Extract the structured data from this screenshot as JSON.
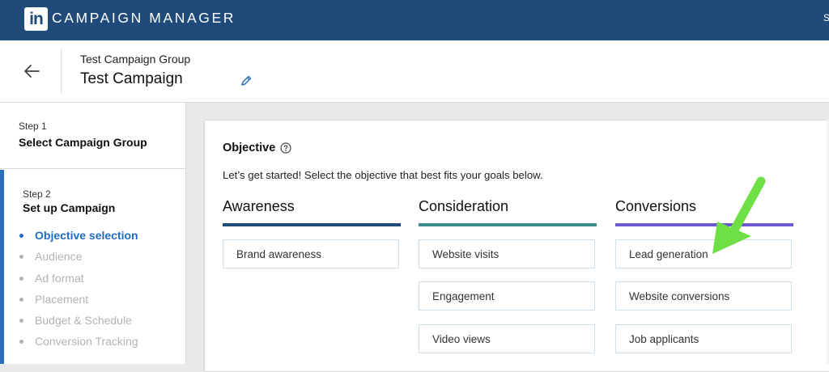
{
  "app": {
    "logo_text": "in",
    "title": "CAMPAIGN MANAGER",
    "top_right_text": "S"
  },
  "header": {
    "group_name": "Test Campaign Group",
    "campaign_name": "Test Campaign"
  },
  "sidebar": {
    "step1": {
      "label": "Step 1",
      "title": "Select Campaign Group"
    },
    "step2": {
      "label": "Step 2",
      "title": "Set up Campaign",
      "items": [
        {
          "label": "Objective selection",
          "active": true
        },
        {
          "label": "Audience",
          "active": false
        },
        {
          "label": "Ad format",
          "active": false
        },
        {
          "label": "Placement",
          "active": false
        },
        {
          "label": "Budget & Schedule",
          "active": false
        },
        {
          "label": "Conversion Tracking",
          "active": false
        }
      ]
    }
  },
  "objective": {
    "title": "Objective",
    "description": "Let’s get started! Select the objective that best fits your goals below.",
    "columns": [
      {
        "title": "Awareness",
        "color": "#1f4a7a",
        "options": [
          "Brand awareness"
        ]
      },
      {
        "title": "Consideration",
        "color": "#3d8b8b",
        "options": [
          "Website visits",
          "Engagement",
          "Video views"
        ]
      },
      {
        "title": "Conversions",
        "color": "#6b5bd0",
        "options": [
          "Lead generation",
          "Website conversions",
          "Job applicants"
        ]
      }
    ]
  },
  "annotation": {
    "arrow_color": "#6ee046"
  },
  "icons": {
    "back": "arrow-left-icon",
    "edit": "pencil-icon",
    "help": "question-circle-icon"
  },
  "colors": {
    "topbar": "#1f4a7a",
    "active_link": "#1f6bc1"
  }
}
